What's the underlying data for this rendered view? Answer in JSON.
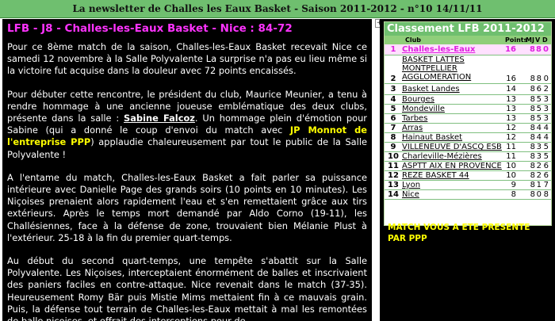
{
  "header": {
    "title": "La newsletter de Challes les Eaux Basket - Saison 2011-2012 - n°10 14/11/11"
  },
  "article": {
    "headline": "LFB - J8 - Challes-les-Eaux Basket - Nice : 84-72",
    "p1": "Pour ce 8ème match de la saison, Challes-les-Eaux Basket recevait Nice ce samedi 12 novembre à la Salle Polyvalente La surprise n'a pas eu lieu même si la victoire fut acquise dans la douleur avec 72 points encaissés.",
    "p2_a": "Pour débuter cette rencontre, le président du club, Maurice Meunier, a tenu à rendre hommage à une ancienne joueuse emblématique des deux clubs, présente dans la salle : ",
    "p2_name": "Sabine Falcoz",
    "p2_b": ". Un hommage plein d'émotion pour Sabine (qui a donné le coup d'envoi du match avec ",
    "p2_sponsor": "JP Monnot de l'entreprise PPP",
    "p2_c": ") applaudie chaleureusement  par tout le public de la Salle Polyvalente  !",
    "p3": "A l'entame du match, Challes-les-Eaux Basket a fait parler sa puissance intérieure avec Danielle Page des grands soirs (10 points en 10 minutes). Les Niçoises prenaient alors rapidement l'eau et s'en remettaient grâce aux tirs extérieurs.  Après le temps mort demandé par Aldo Corno (19-11), les Challésiennes,  face à la défense de zone, trouvaient bien Mélanie Plust à l'extérieur.  25-18 à la fin du premier quart-temps.",
    "p4": "Au début du second quart-temps, une tempête s'abattit sur la Salle Polyvalente. Les Niçoises, interceptaient énormément de balles et inscrivaient des paniers faciles en contre-attaque. Nice revenait dans le match (37-35). Heureusement  Romy Bär puis Mistie Mims mettaient fin à ce mauvais grain. Puis, la défense tout terrain de Challes-les-Eaux  mettait à mal les remontées de balle niçoises, et offrait des interceptions pour de"
  },
  "standings": {
    "title": "Classement LFB 2011-2012",
    "columns": {
      "club": "Club",
      "pts": "Points",
      "mj": "MJ",
      "v": "V",
      "d": "D"
    },
    "rows": [
      {
        "rank": "1",
        "club": "Challes-les-Eaux",
        "pts": "16",
        "mj": "8",
        "v": "8",
        "d": "0"
      },
      {
        "rank": "2",
        "club": "BASKET LATTES MONTPELLIER AGGLOMERATION",
        "pts": "16",
        "mj": "8",
        "v": "8",
        "d": "0"
      },
      {
        "rank": "3",
        "club": "Basket Landes",
        "pts": "14",
        "mj": "8",
        "v": "6",
        "d": "2"
      },
      {
        "rank": "4",
        "club": "Bourges",
        "pts": "13",
        "mj": "8",
        "v": "5",
        "d": "3"
      },
      {
        "rank": "5",
        "club": "Mondeville",
        "pts": "13",
        "mj": "8",
        "v": "5",
        "d": "3"
      },
      {
        "rank": "6",
        "club": "Tarbes",
        "pts": "13",
        "mj": "8",
        "v": "5",
        "d": "3"
      },
      {
        "rank": "7",
        "club": "Arras",
        "pts": "12",
        "mj": "8",
        "v": "4",
        "d": "4"
      },
      {
        "rank": "8",
        "club": "Hainaut Basket",
        "pts": "12",
        "mj": "8",
        "v": "4",
        "d": "4"
      },
      {
        "rank": "9",
        "club": "VILLENEUVE D'ASCQ ESB",
        "pts": "11",
        "mj": "8",
        "v": "3",
        "d": "5"
      },
      {
        "rank": "10",
        "club": "Charleville-Mézières",
        "pts": "11",
        "mj": "8",
        "v": "3",
        "d": "5"
      },
      {
        "rank": "11",
        "club": "ASPTT AIX EN PROVENCE",
        "pts": "10",
        "mj": "8",
        "v": "2",
        "d": "6"
      },
      {
        "rank": "12",
        "club": "REZE BASKET 44",
        "pts": "10",
        "mj": "8",
        "v": "2",
        "d": "6"
      },
      {
        "rank": "13",
        "club": "Lyon",
        "pts": "9",
        "mj": "8",
        "v": "1",
        "d": "7"
      },
      {
        "rank": "14",
        "club": "Nice",
        "pts": "8",
        "mj": "8",
        "v": "0",
        "d": "8"
      }
    ]
  },
  "sponsor_note": "MATCH VOUS A ETE PRESENTE PAR PPP",
  "colors": {
    "accent_green": "#6fbf6f",
    "headline_magenta": "#ff33ff",
    "sponsor_yellow": "#ffff00"
  }
}
